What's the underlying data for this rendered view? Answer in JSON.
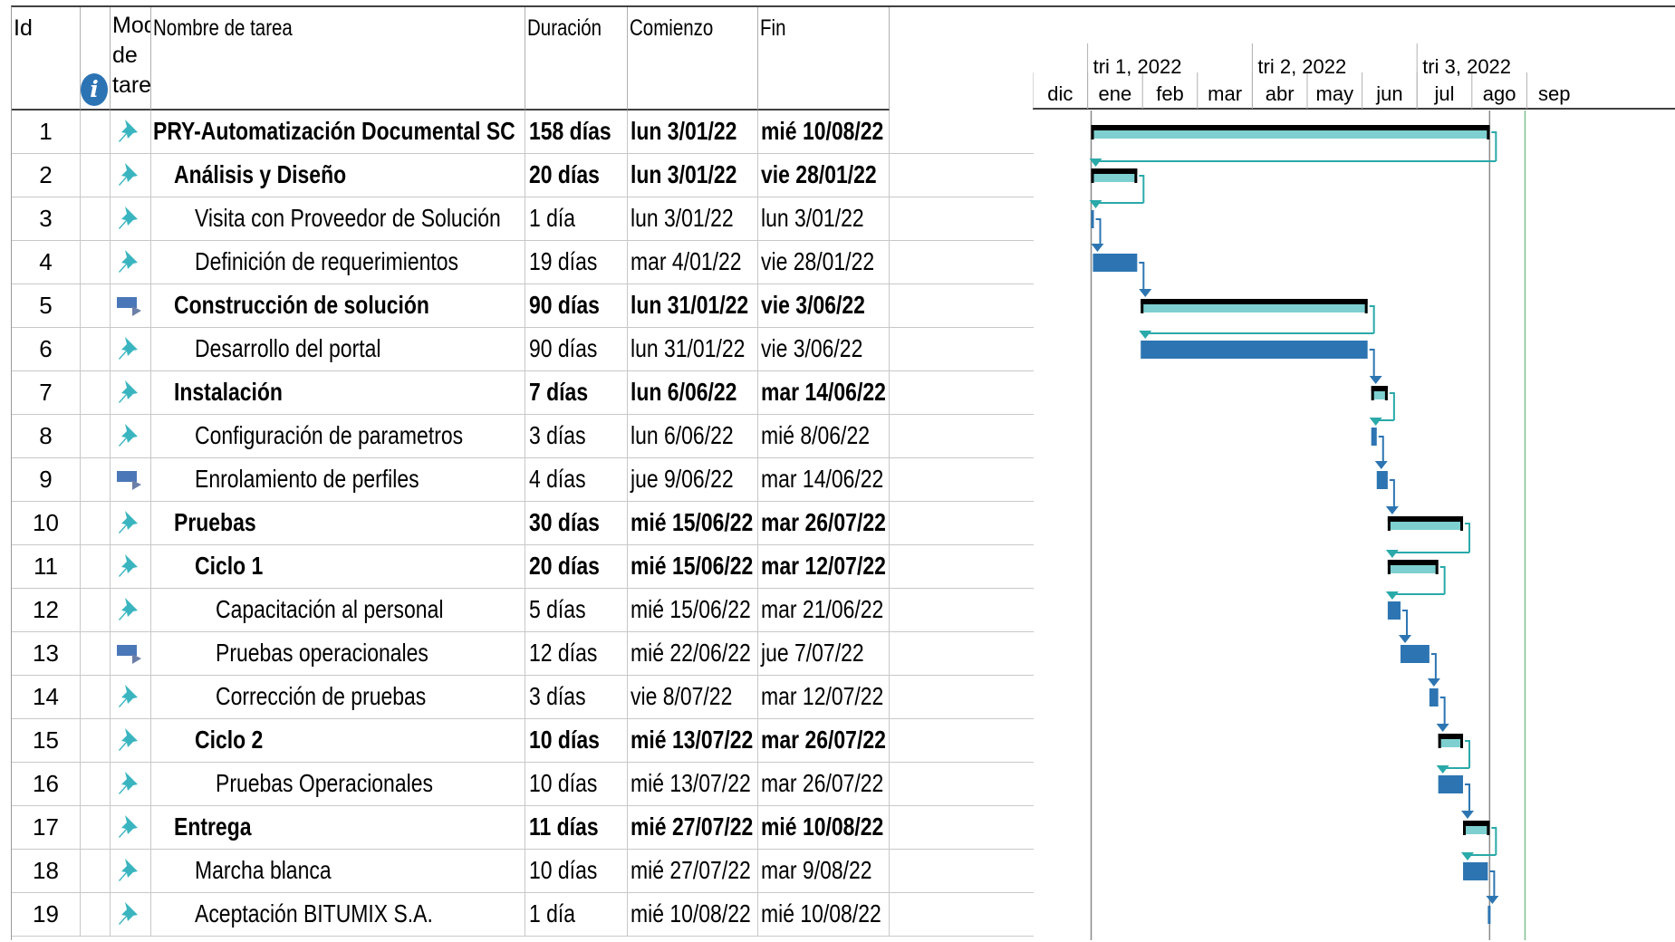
{
  "columns": {
    "id": "Id",
    "mode_lines": [
      "Modo",
      "de",
      "tarea"
    ],
    "name": "Nombre de tarea",
    "duration": "Duración",
    "start": "Comienzo",
    "finish": "Fin",
    "info_icon": "info-icon"
  },
  "timescale": {
    "quarters": [
      "tri 1, 2022",
      "tri 2, 2022",
      "tri 3, 2022"
    ],
    "months": [
      "dic",
      "ene",
      "feb",
      "mar",
      "abr",
      "may",
      "jun",
      "jul",
      "ago",
      "sep"
    ]
  },
  "colors": {
    "summary_bar": "#000000",
    "summary_progress": "#7ecfd0",
    "task_bar": "#2d75b2",
    "link_line": "#2aa9a9",
    "manual_icon": "#3ab5c0",
    "auto_icon": "#4a77b8"
  },
  "tasks": [
    {
      "id": "1",
      "mode": "manual",
      "indent": 0,
      "summary": true,
      "name": "PRY-Automatización Documental SC",
      "duration": "158 días",
      "start": "lun 3/01/22",
      "finish": "mié 10/08/22"
    },
    {
      "id": "2",
      "mode": "manual",
      "indent": 1,
      "summary": true,
      "name": "Análisis y Diseño",
      "duration": "20 días",
      "start": "lun 3/01/22",
      "finish": "vie 28/01/22"
    },
    {
      "id": "3",
      "mode": "manual",
      "indent": 2,
      "summary": false,
      "name": "Visita con Proveedor de Solución",
      "duration": "1 día",
      "start": "lun 3/01/22",
      "finish": "lun 3/01/22"
    },
    {
      "id": "4",
      "mode": "manual",
      "indent": 2,
      "summary": false,
      "name": "Definición de requerimientos",
      "duration": "19 días",
      "start": "mar 4/01/22",
      "finish": "vie 28/01/22"
    },
    {
      "id": "5",
      "mode": "auto",
      "indent": 1,
      "summary": true,
      "name": "Construcción de solución",
      "duration": "90 días",
      "start": "lun 31/01/22",
      "finish": "vie 3/06/22"
    },
    {
      "id": "6",
      "mode": "manual",
      "indent": 2,
      "summary": false,
      "name": "Desarrollo del portal",
      "duration": "90 días",
      "start": "lun 31/01/22",
      "finish": "vie 3/06/22"
    },
    {
      "id": "7",
      "mode": "manual",
      "indent": 1,
      "summary": true,
      "name": "Instalación",
      "duration": "7 días",
      "start": "lun 6/06/22",
      "finish": "mar 14/06/22"
    },
    {
      "id": "8",
      "mode": "manual",
      "indent": 2,
      "summary": false,
      "name": "Configuración  de parametros",
      "duration": "3 días",
      "start": "lun 6/06/22",
      "finish": "mié 8/06/22"
    },
    {
      "id": "9",
      "mode": "auto",
      "indent": 2,
      "summary": false,
      "name": "Enrolamiento de perfiles",
      "duration": "4 días",
      "start": "jue 9/06/22",
      "finish": "mar 14/06/22"
    },
    {
      "id": "10",
      "mode": "manual",
      "indent": 1,
      "summary": true,
      "name": "Pruebas",
      "duration": "30 días",
      "start": "mié 15/06/22",
      "finish": "mar 26/07/22"
    },
    {
      "id": "11",
      "mode": "manual",
      "indent": 2,
      "summary": true,
      "name": "Ciclo 1",
      "duration": "20 días",
      "start": "mié 15/06/22",
      "finish": "mar 12/07/22"
    },
    {
      "id": "12",
      "mode": "manual",
      "indent": 3,
      "summary": false,
      "name": "Capacitación al personal",
      "duration": "5 días",
      "start": "mié 15/06/22",
      "finish": "mar 21/06/22"
    },
    {
      "id": "13",
      "mode": "auto",
      "indent": 3,
      "summary": false,
      "name": "Pruebas operacionales",
      "duration": "12 días",
      "start": "mié 22/06/22",
      "finish": "jue 7/07/22"
    },
    {
      "id": "14",
      "mode": "manual",
      "indent": 3,
      "summary": false,
      "name": "Corrección de pruebas",
      "duration": "3 días",
      "start": "vie 8/07/22",
      "finish": "mar 12/07/22"
    },
    {
      "id": "15",
      "mode": "manual",
      "indent": 2,
      "summary": true,
      "name": "Ciclo 2",
      "duration": "10 días",
      "start": "mié 13/07/22",
      "finish": "mar 26/07/22"
    },
    {
      "id": "16",
      "mode": "manual",
      "indent": 3,
      "summary": false,
      "name": "Pruebas Operacionales",
      "duration": "10 días",
      "start": "mié 13/07/22",
      "finish": "mar 26/07/22"
    },
    {
      "id": "17",
      "mode": "manual",
      "indent": 1,
      "summary": true,
      "name": "Entrega",
      "duration": "11 días",
      "start": "mié 27/07/22",
      "finish": "mié 10/08/22"
    },
    {
      "id": "18",
      "mode": "manual",
      "indent": 2,
      "summary": false,
      "name": "Marcha blanca",
      "duration": "10 días",
      "start": "mié 27/07/22",
      "finish": "mar 9/08/22"
    },
    {
      "id": "19",
      "mode": "manual",
      "indent": 2,
      "summary": false,
      "name": "Aceptación BITUMIX S.A.",
      "duration": "1 día",
      "start": "mié 10/08/22",
      "finish": "mié 10/08/22"
    }
  ]
}
